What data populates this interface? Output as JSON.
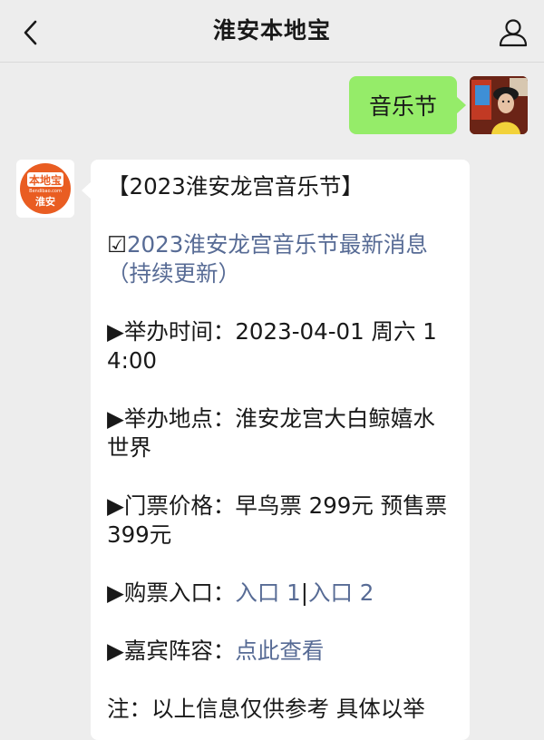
{
  "header": {
    "title": "淮安本地宝",
    "back_icon": "chevron-left-icon",
    "user_icon": "person-icon"
  },
  "outgoing": {
    "text": "音乐节"
  },
  "bot_avatar": {
    "logo_top": "本地宝",
    "logo_url": "Bendibao.com",
    "logo_city": "淮安",
    "accent": "#e95d22"
  },
  "message": {
    "title": "【2023淮安龙宫音乐节】",
    "news_prefix": "☑",
    "news_link": "2023淮安龙宫音乐节最新消息（持续更新）",
    "time_label": "▶举办时间：",
    "time_value": "2023-04-01 周六 14:00",
    "place_label": "▶举办地点：",
    "place_value": "淮安龙宫大白鲸嬉水世界",
    "price_label": "▶门票价格：",
    "price_value": "早鸟票 299元 预售票 399元",
    "ticket_label": "▶购票入口：",
    "ticket_link1": "入口 1",
    "ticket_sep": "|",
    "ticket_link2": "入口 2",
    "guest_label": "▶嘉宾阵容：",
    "guest_link": "点此查看",
    "note": "注：以上信息仅供参考 具体以举"
  },
  "colors": {
    "bubble_out": "#95ec69",
    "link": "#576b95",
    "background": "#ededed"
  }
}
